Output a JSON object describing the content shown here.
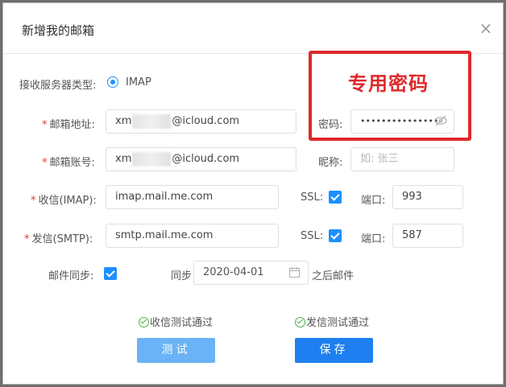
{
  "dialog": {
    "title": "新增我的邮箱",
    "close_glyph": "×"
  },
  "form": {
    "receive_type_label": "接收服务器类型:",
    "receive_type_option": "IMAP",
    "email_address_label": "邮箱地址:",
    "email_address_prefix": "xm",
    "email_address_suffix": "@icloud.com",
    "password_label": "密码:",
    "password_value": "•••••••••••••••",
    "email_account_label": "邮箱账号:",
    "email_account_prefix": "xm",
    "email_account_suffix": "@icloud.com",
    "nickname_label": "昵称:",
    "nickname_placeholder": "如: 张三",
    "imap_label": "收信(IMAP):",
    "imap_value": "imap.mail.me.com",
    "imap_ssl_label": "SSL:",
    "imap_port_label": "端口:",
    "imap_port_value": "993",
    "smtp_label": "发信(SMTP):",
    "smtp_value": "smtp.mail.me.com",
    "smtp_ssl_label": "SSL:",
    "smtp_port_label": "端口:",
    "smtp_port_value": "587",
    "sync_label": "邮件同步:",
    "sync_from_label": "同步",
    "sync_date_value": "2020-04-01",
    "sync_after_label": "之后邮件",
    "required_mark": "*"
  },
  "status": {
    "receive_ok": "收信测试通过",
    "send_ok": "发信测试通过"
  },
  "buttons": {
    "test_label": "测试",
    "save_label": "保存"
  },
  "annotation": {
    "text": "专用密码",
    "color": "#e0282b"
  },
  "colors": {
    "accent": "#1e7ff0",
    "required": "#e03a3a",
    "success": "#49b34a"
  },
  "icons": [
    "close-icon",
    "radio-selected-icon",
    "eye-off-icon",
    "checkbox-checked-icon",
    "calendar-icon",
    "check-circle-icon"
  ]
}
